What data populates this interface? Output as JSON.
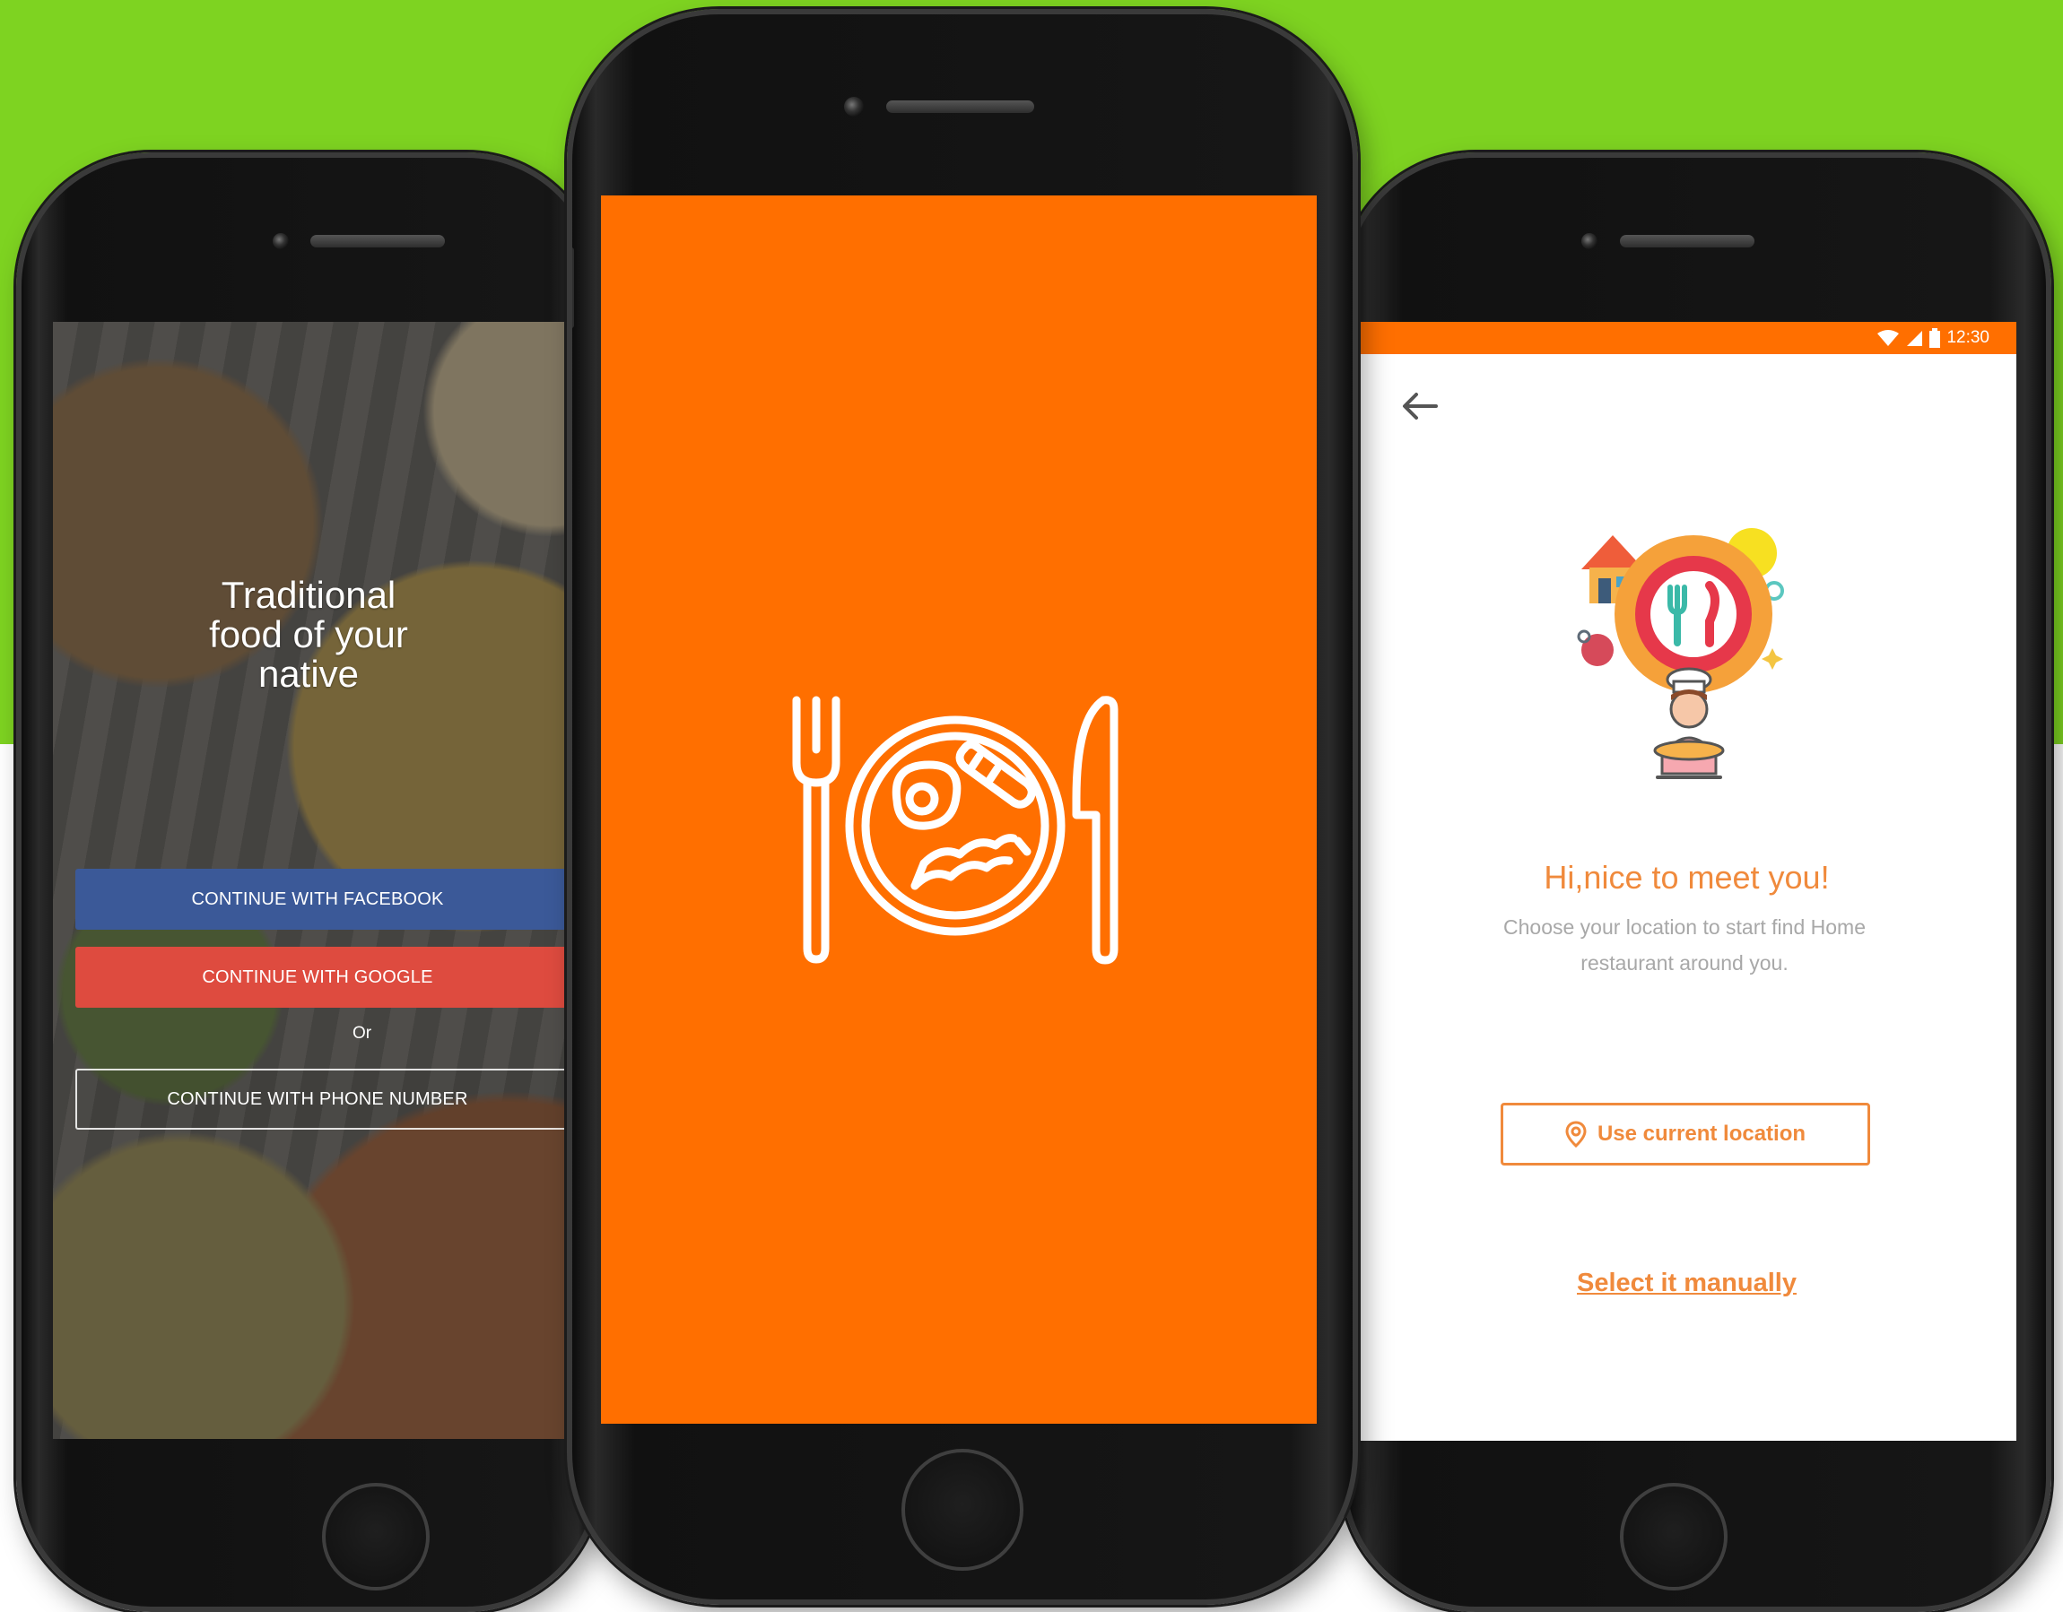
{
  "background": {
    "color": "#7ed321"
  },
  "left_screen": {
    "headline": "Traditional\nfood of  your\nnative",
    "facebook_label": "CONTINUE WITH FACEBOOK",
    "google_label": "CONTINUE WITH GOOGLE",
    "or_label": "Or",
    "phone_label": "CONTINUE WITH PHONE NUMBER",
    "colors": {
      "facebook": "#3b5998",
      "google": "#de4b3f"
    }
  },
  "center_screen": {
    "color": "#ff6f00",
    "logo_icon": "plate-fork-knife-icon"
  },
  "right_screen": {
    "status_time": "12:30",
    "back_icon": "arrow-left-icon",
    "illustration": "chef-location-illustration",
    "greeting": "Hi,nice to meet you!",
    "subtitle": "Choose your location to start find Home restaurant around you.",
    "use_location_label": "Use current location",
    "select_manually_label": "Select it manually",
    "accent": "#f08a3c"
  }
}
